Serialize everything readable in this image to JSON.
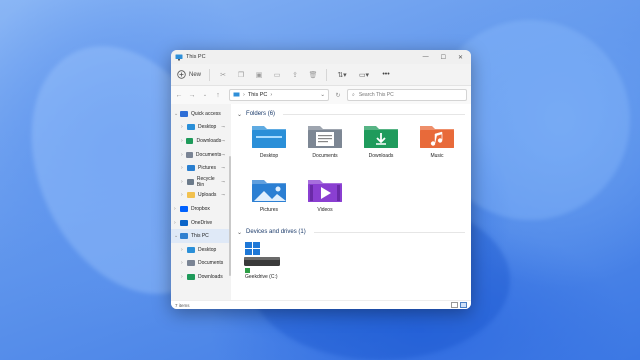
{
  "window": {
    "title": "This PC",
    "controls": {
      "minimize": "—",
      "maximize": "☐",
      "close": "✕"
    }
  },
  "toolbar": {
    "new_label": "New",
    "cut_icon": "scissors-icon",
    "sort_icon": "sort-icon",
    "view_icon": "view-icon",
    "more": "•••"
  },
  "address": {
    "location": "This PC",
    "search_placeholder": "Search This PC"
  },
  "sidebar": {
    "items": [
      {
        "label": "Quick access",
        "icon": "star-icon",
        "color": "#2f6fd6",
        "expanded": true
      },
      {
        "label": "Desktop",
        "icon": "desktop-icon",
        "color": "#2a8fd8",
        "pinned": true
      },
      {
        "label": "Downloads",
        "icon": "download-icon",
        "color": "#1e9a5a",
        "pinned": true
      },
      {
        "label": "Documents",
        "icon": "documents-icon",
        "color": "#7a8494",
        "pinned": true
      },
      {
        "label": "Pictures",
        "icon": "pictures-icon",
        "color": "#2a7fd0",
        "pinned": true
      },
      {
        "label": "Recycle Bin",
        "icon": "recycle-bin-icon",
        "color": "#6b7a8a",
        "pinned": true
      },
      {
        "label": "Uploads",
        "icon": "folder-icon",
        "color": "#f2c14e",
        "pinned": true
      },
      {
        "label": "Dropbox",
        "icon": "dropbox-icon",
        "color": "#0061fe"
      },
      {
        "label": "OneDrive",
        "icon": "onedrive-icon",
        "color": "#0a64c8"
      },
      {
        "label": "This PC",
        "icon": "this-pc-icon",
        "color": "#2f7fd0",
        "active": true
      },
      {
        "label": "Desktop",
        "icon": "desktop-icon",
        "color": "#2a8fd8"
      },
      {
        "label": "Documents",
        "icon": "documents-icon",
        "color": "#7a8494"
      },
      {
        "label": "Downloads",
        "icon": "download-icon",
        "color": "#1e9a5a"
      }
    ]
  },
  "content": {
    "folders_header": "Folders (6)",
    "folders": [
      {
        "label": "Desktop",
        "icon": "desktop-folder-icon",
        "color": "#2a8fd8"
      },
      {
        "label": "Documents",
        "icon": "documents-folder-icon",
        "color": "#7d8794"
      },
      {
        "label": "Downloads",
        "icon": "downloads-folder-icon",
        "color": "#1f9b5c"
      },
      {
        "label": "Music",
        "icon": "music-folder-icon",
        "color": "#e86a3a"
      },
      {
        "label": "Pictures",
        "icon": "pictures-folder-icon",
        "color": "#2b7fd3"
      },
      {
        "label": "Videos",
        "icon": "videos-folder-icon",
        "color": "#8a3fd1"
      }
    ],
    "drives_header": "Devices and drives (1)",
    "drives": [
      {
        "label": "Geekdrive (C:)",
        "icon": "hard-drive-icon"
      }
    ]
  },
  "status": {
    "item_count": "7 items"
  }
}
